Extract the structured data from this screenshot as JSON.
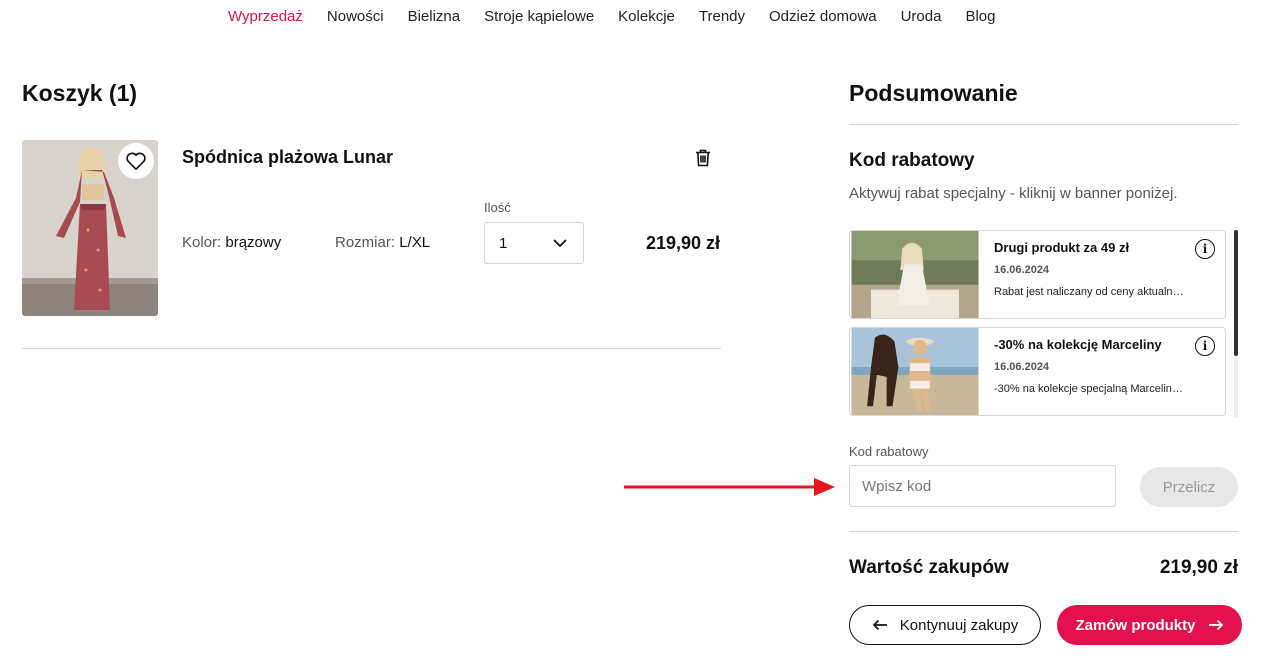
{
  "nav": {
    "items": [
      "Wyprzedaż",
      "Nowości",
      "Bielizna",
      "Stroje kąpielowe",
      "Kolekcje",
      "Trendy",
      "Odzież domowa",
      "Uroda",
      "Blog"
    ],
    "highlight_color": "#d8154b"
  },
  "cart": {
    "title": "Koszyk (1)",
    "item": {
      "name": "Spódnica plażowa Lunar",
      "color_label": "Kolor:",
      "color_value": "brązowy",
      "size_label": "Rozmiar:",
      "size_value": "L/XL",
      "qty_label": "Ilość",
      "qty_value": "1",
      "price": "219,90 zł",
      "icons": [
        "heart-icon",
        "trash-icon",
        "chevron-down-icon"
      ]
    }
  },
  "summary": {
    "title": "Podsumowanie",
    "code_title": "Kod rabatowy",
    "code_subtitle": "Aktywuj rabat specjalny - kliknij w banner poniżej.",
    "promos": [
      {
        "title": "Drugi produkt za 49 zł",
        "date": "16.06.2024",
        "desc": "Rabat jest naliczany od ceny aktualnej..."
      },
      {
        "title": "-30% na kolekcję Marceliny",
        "date": "16.06.2024",
        "desc": "-30% na kolekcje specjalną Marceliny..."
      }
    ],
    "code_label": "Kod rabatowy",
    "code_placeholder": "Wpisz kod",
    "recalc_label": "Przelicz",
    "total_label": "Wartość zakupów",
    "total_value": "219,90 zł",
    "continue_label": "Kontynuuj zakupy",
    "order_label": "Zamów produkty",
    "accent_color": "#e2104c",
    "annotation_arrow_color": "#e8141e"
  }
}
